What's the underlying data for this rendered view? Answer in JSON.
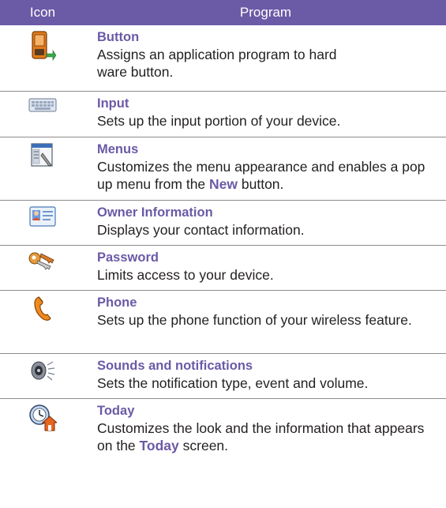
{
  "header": {
    "icon": "Icon",
    "program": "Program"
  },
  "rows": [
    {
      "name": "Button",
      "desc": "Assigns an application program to hard ware button.",
      "icon": "pda-button-icon"
    },
    {
      "name": "Input",
      "desc": "Sets up the input portion of your device.",
      "icon": "keyboard-icon"
    },
    {
      "name": "Menus",
      "desc_a": "Customizes the menu appearance and enables a pop up menu from the ",
      "desc_b": "New",
      "desc_c": " button.",
      "icon": "menu-window-icon"
    },
    {
      "name": "Owner Information",
      "desc": "Displays your contact information.",
      "icon": "contact-card-icon"
    },
    {
      "name": "Password",
      "desc": "Limits access to your device.",
      "icon": "keys-icon"
    },
    {
      "name": "Phone",
      "desc": "Sets up the phone function of your wireless feature.",
      "icon": "phone-handset-icon"
    },
    {
      "name": "Sounds and notifications",
      "desc": "Sets the notification type, event and volume.",
      "icon": "speaker-icon"
    },
    {
      "name": "Today",
      "desc_a": "Customizes the look and the information that appears on the ",
      "desc_b": "Today",
      "desc_c": " screen.",
      "icon": "clock-home-icon"
    }
  ]
}
